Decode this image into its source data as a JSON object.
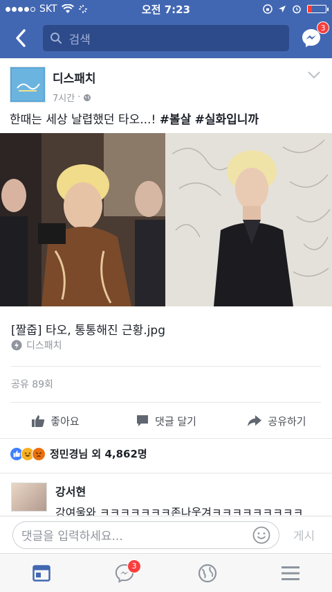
{
  "status_bar": {
    "carrier": "SKT",
    "time": "오전 7:23"
  },
  "nav": {
    "search_placeholder": "검색",
    "messenger_badge": "3"
  },
  "post": {
    "page_name": "디스패치",
    "time": "7시간",
    "time_separator": "·",
    "text_prefix": "한때는 세상 날렵했던 타오...! ",
    "hashtag1": "#볼살",
    "hashtag2": "#실화입니까",
    "link_title": "[짤줍] 타오, 통통해진 근황.jpg",
    "link_source": "디스패치",
    "shares": "공유 89회",
    "actions": {
      "like": "좋아요",
      "comment": "댓글 달기",
      "share": "공유하기"
    },
    "reactions_text": "정민경님 외 4,862명"
  },
  "comment": {
    "author": "강서현",
    "text": "강여울와 ㅋㅋㅋㅋㅋㅋㅋ존나웃겨ㅋㅋㅋㅋㅋㅋㅋㅋㅋ"
  },
  "comment_bar": {
    "placeholder": "댓글을 입력하세요...",
    "post_label": "게시"
  },
  "tab_bar": {
    "messenger_badge": "3"
  },
  "colors": {
    "brand": "#4267b2",
    "badge": "#fa3e3e",
    "like": "#4080ff",
    "angry": "#e9710f",
    "haha": "#f7b125"
  }
}
